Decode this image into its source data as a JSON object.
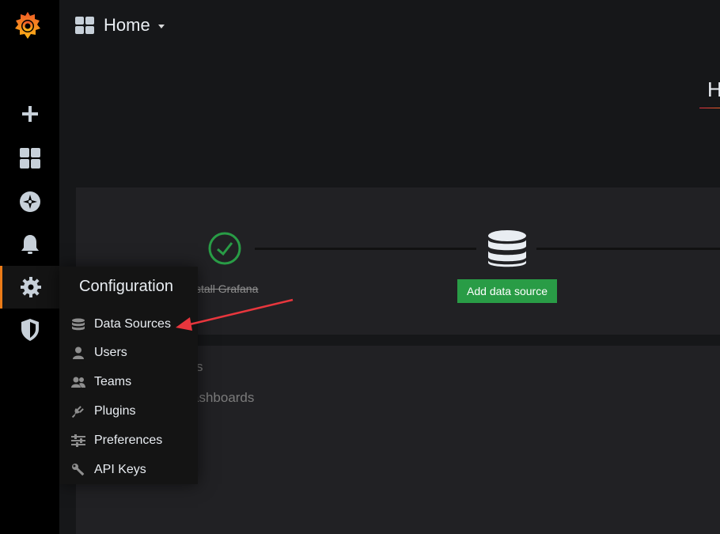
{
  "header": {
    "title": "Home",
    "page_heading_partial": "H"
  },
  "sidebar": {
    "items": [
      {
        "icon": "plus-icon"
      },
      {
        "icon": "dashboards-grid-icon"
      },
      {
        "icon": "explore-compass-icon"
      },
      {
        "icon": "alerting-bell-icon"
      },
      {
        "icon": "configuration-gear-icon",
        "active": true
      },
      {
        "icon": "shield-icon"
      }
    ]
  },
  "getting_started": {
    "step1_label": "stall Grafana",
    "add_data_source_label": "Add data source",
    "faded_text_1": "s",
    "faded_text_2": "ashboards"
  },
  "config_menu": {
    "title": "Configuration",
    "items": [
      {
        "label": "Data Sources",
        "icon": "database-icon"
      },
      {
        "label": "Users",
        "icon": "user-icon"
      },
      {
        "label": "Teams",
        "icon": "users-icon"
      },
      {
        "label": "Plugins",
        "icon": "plug-icon"
      },
      {
        "label": "Preferences",
        "icon": "sliders-icon"
      },
      {
        "label": "API Keys",
        "icon": "key-icon"
      }
    ]
  },
  "colors": {
    "accent_orange": "#eb7b18",
    "success_green": "#299c46",
    "annotation_red": "#e8363d"
  }
}
